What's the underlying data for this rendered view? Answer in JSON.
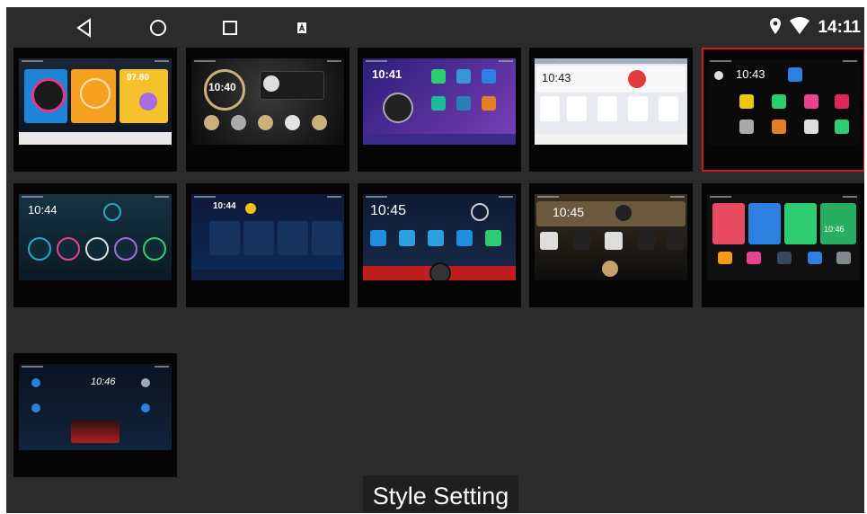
{
  "status": {
    "time": "14:11",
    "icons": [
      "location-icon",
      "wifi-icon"
    ]
  },
  "navigation": [
    "back-icon",
    "home-icon",
    "recents-icon",
    "screenshot-icon"
  ],
  "themes": [
    {
      "id": 1,
      "clock": "",
      "accent": "#f6a623"
    },
    {
      "id": 2,
      "clock": "10:40",
      "accent": "#c9b27a"
    },
    {
      "id": 3,
      "clock": "10:41",
      "accent": "#6a4cc2"
    },
    {
      "id": 4,
      "clock": "10:43",
      "accent": "#e23b3b"
    },
    {
      "id": 5,
      "clock": "10:43",
      "accent": "#d4142b",
      "selected": true
    },
    {
      "id": 6,
      "clock": "10:44",
      "accent": "#2aa6c8"
    },
    {
      "id": 7,
      "clock": "10:44",
      "accent": "#1f8ee0"
    },
    {
      "id": 8,
      "clock": "10:45",
      "accent": "#e02626"
    },
    {
      "id": 9,
      "clock": "10:45",
      "accent": "#c6a26a"
    },
    {
      "id": 10,
      "clock": "10:46",
      "accent": "#2ecc71"
    },
    {
      "id": 11,
      "clock": "10:46",
      "accent": "#2d7fe0"
    }
  ],
  "footer": {
    "title": "Style Setting"
  }
}
